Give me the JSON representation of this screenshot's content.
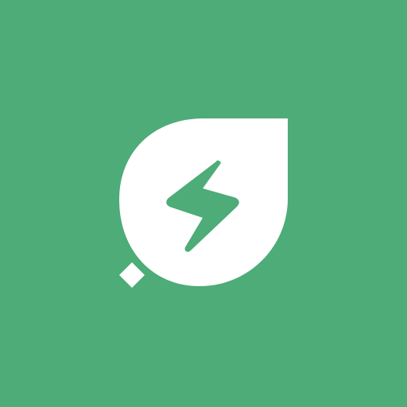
{
  "icon": {
    "name": "leaf-lightning-bolt-icon",
    "colors": {
      "background": "#4dac77",
      "leaf": "#ffffff",
      "bolt": "#4dac77"
    }
  }
}
